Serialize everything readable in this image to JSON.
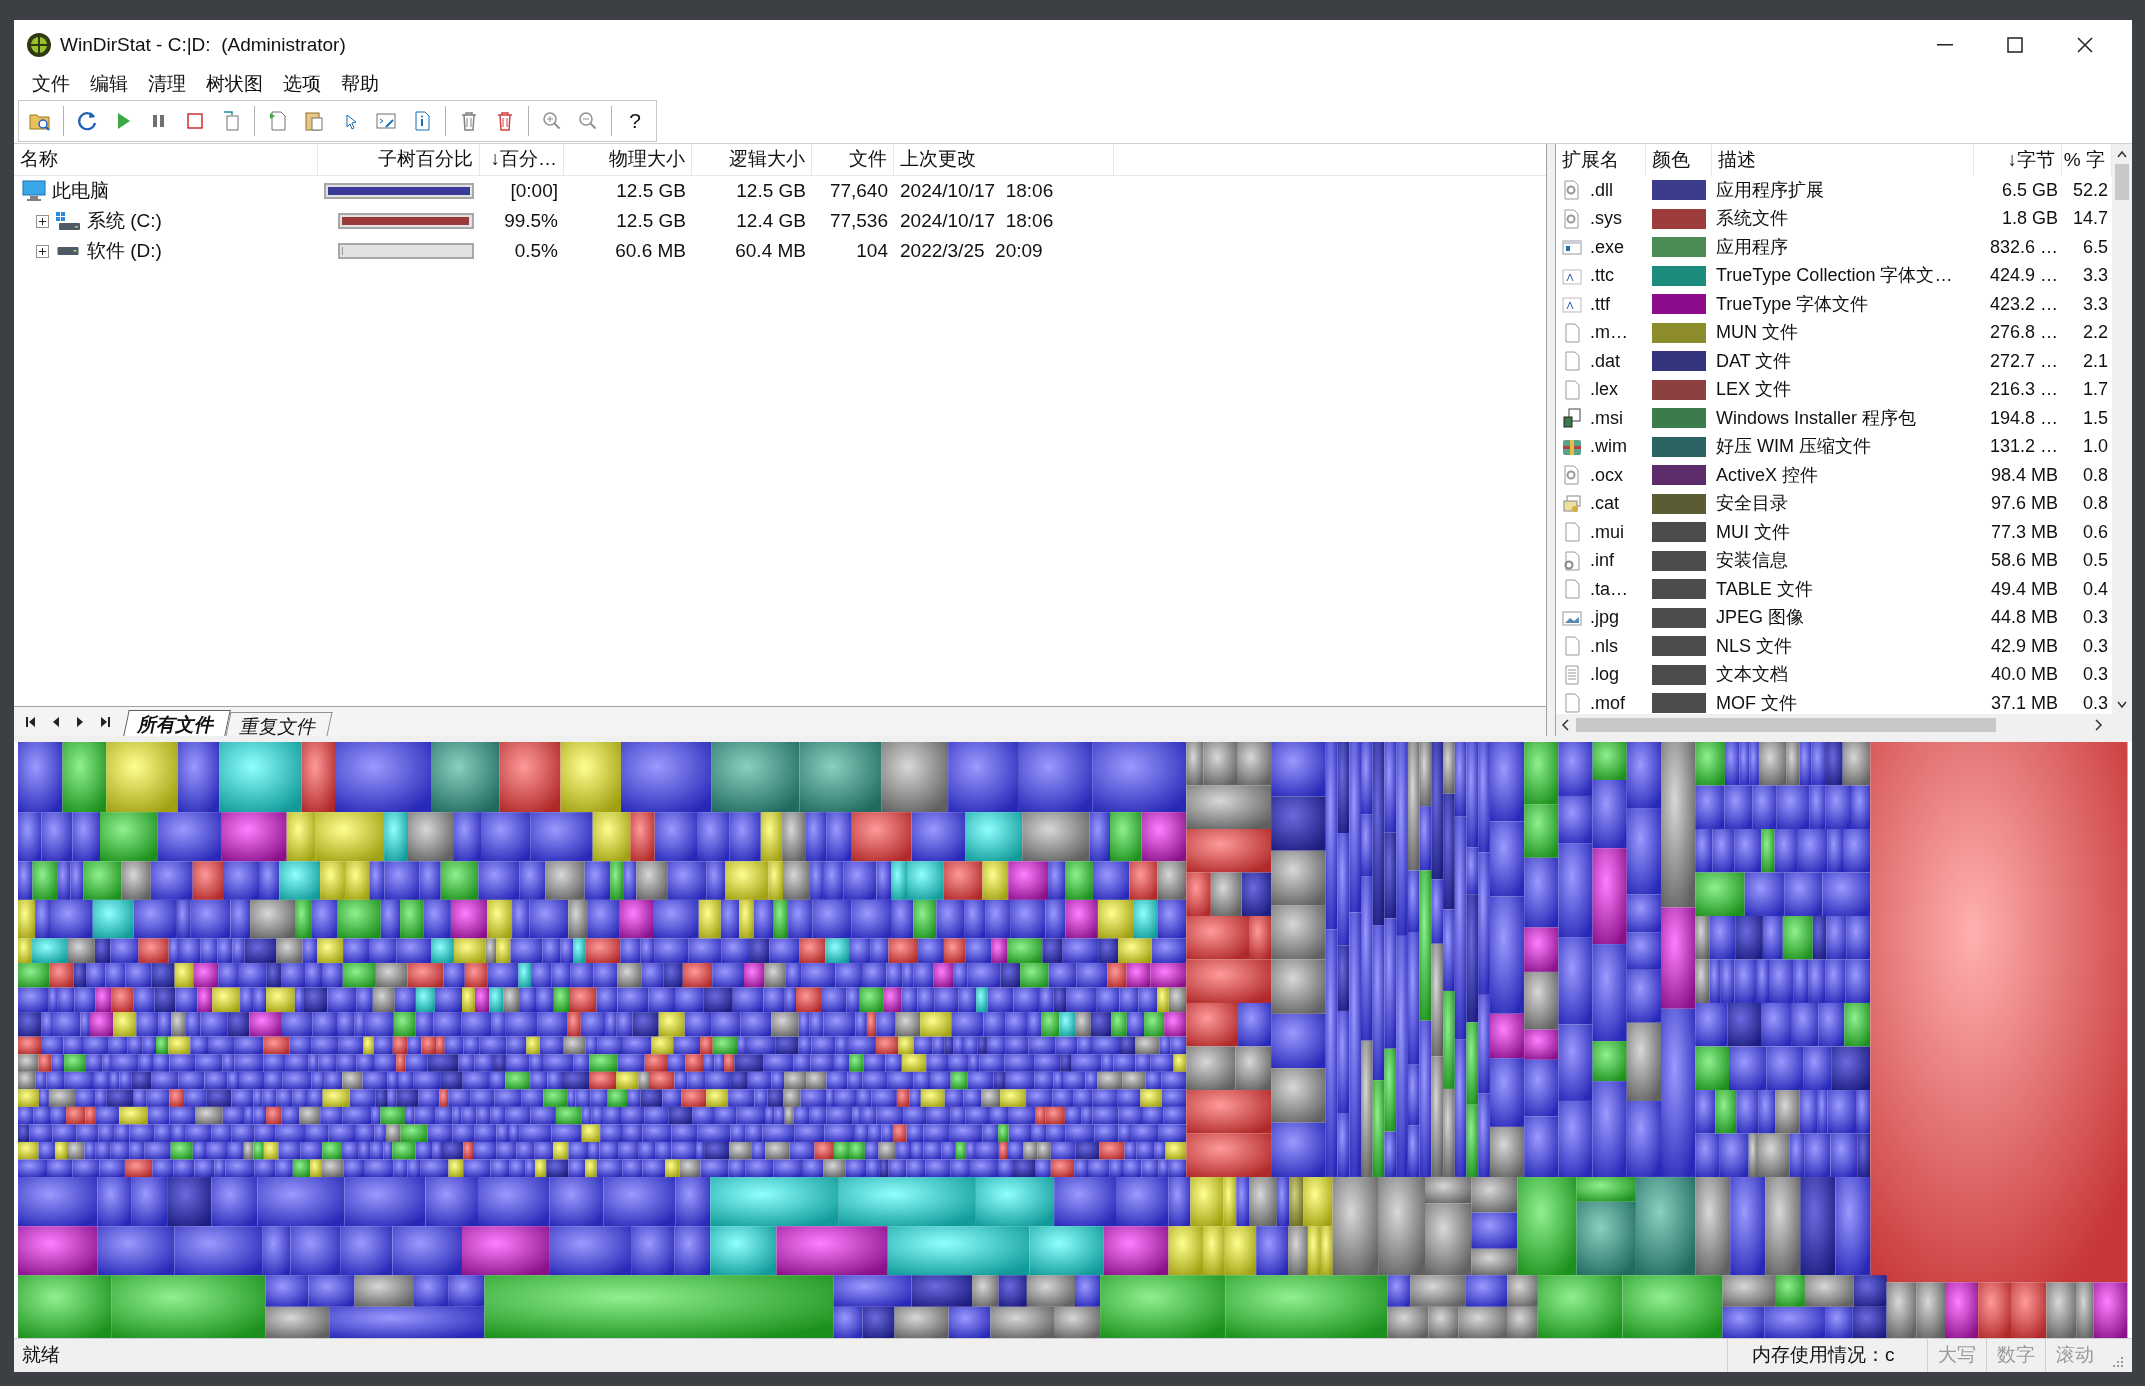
{
  "window": {
    "title": "WinDirStat - C:|D:  (Administrator)"
  },
  "menu": [
    "文件",
    "编辑",
    "清理",
    "树状图",
    "选项",
    "帮助"
  ],
  "toolbar": [
    {
      "kind": "open"
    },
    {
      "kind": "separator"
    },
    {
      "kind": "refresh"
    },
    {
      "kind": "play"
    },
    {
      "kind": "pause"
    },
    {
      "kind": "stop"
    },
    {
      "kind": "copy"
    },
    {
      "kind": "separator"
    },
    {
      "kind": "new-document"
    },
    {
      "kind": "paste"
    },
    {
      "kind": "pointer"
    },
    {
      "kind": "console"
    },
    {
      "kind": "info"
    },
    {
      "kind": "separator"
    },
    {
      "kind": "trash"
    },
    {
      "kind": "trash-red"
    },
    {
      "kind": "separator"
    },
    {
      "kind": "zoom-in"
    },
    {
      "kind": "zoom-out"
    },
    {
      "kind": "separator"
    },
    {
      "kind": "help",
      "label": "?"
    }
  ],
  "tree": {
    "columns": [
      "名称",
      "子树百分比",
      "↓百分…",
      "物理大小",
      "逻辑大小",
      "文件",
      "上次更改"
    ],
    "rows": [
      {
        "kind": "computer",
        "name": "此电脑",
        "color": "#3a3a9a",
        "level": 1,
        "percent": "[0:00]",
        "physical": "12.5 GB",
        "logical": "12.5 GB",
        "files": "77,640",
        "modified": "2024/10/17  18:06",
        "children": [
          {
            "kind": "system-drive",
            "name": "系统 (C:)",
            "expanded": false,
            "color": "#9a3a3a",
            "level": 0.995,
            "percent": "99.5%",
            "physical": "12.5 GB",
            "logical": "12.4 GB",
            "files": "77,536",
            "modified": "2024/10/17  18:06"
          },
          {
            "kind": "drive",
            "name": "软件 (D:)",
            "expanded": false,
            "color": "#9a9a9a",
            "level": 0.005,
            "percent": "0.5%",
            "physical": "60.6 MB",
            "logical": "60.4 MB",
            "files": "104",
            "modified": "2022/3/25  20:09"
          }
        ]
      }
    ]
  },
  "tabs": [
    {
      "label": "所有文件",
      "selected": true
    },
    {
      "label": "重复文件",
      "selected": false
    }
  ],
  "extensions": {
    "columns": [
      "扩展名",
      "颜色",
      "描述",
      "↓字节",
      "% 字"
    ],
    "rows": [
      {
        "kind": "gear-file",
        "ext": ".dll",
        "color": "#3c3c8c",
        "description": "应用程序扩展",
        "bytes": "6.5 GB",
        "percent": "52.2"
      },
      {
        "kind": "gear-file",
        "ext": ".sys",
        "color": "#9c3c3c",
        "description": "系统文件",
        "bytes": "1.8 GB",
        "percent": "14.7"
      },
      {
        "kind": "window",
        "ext": ".exe",
        "color": "#4c8c54",
        "description": "应用程序",
        "bytes": "832.6 …",
        "percent": "6.5"
      },
      {
        "kind": "font",
        "ext": ".ttc",
        "color": "#1c8c7c",
        "description": "TrueType Collection 字体文…",
        "bytes": "424.9 …",
        "percent": "3.3"
      },
      {
        "kind": "font",
        "ext": ".ttf",
        "color": "#8c0c8c",
        "description": "TrueType 字体文件",
        "bytes": "423.2 …",
        "percent": "3.3"
      },
      {
        "kind": "blank",
        "ext": ".m…",
        "color": "#8c8c2c",
        "description": "MUN 文件",
        "bytes": "276.8 …",
        "percent": "2.2"
      },
      {
        "kind": "blank",
        "ext": ".dat",
        "color": "#34347c",
        "description": "DAT 文件",
        "bytes": "272.7 …",
        "percent": "2.1"
      },
      {
        "kind": "blank",
        "ext": ".lex",
        "color": "#8c4040",
        "description": "LEX 文件",
        "bytes": "216.3 …",
        "percent": "1.7"
      },
      {
        "kind": "installer",
        "ext": ".msi",
        "color": "#3c7c4c",
        "description": "Windows Installer 程序包",
        "bytes": "194.8 …",
        "percent": "1.5"
      },
      {
        "kind": "archive",
        "ext": ".wim",
        "color": "#2c6464",
        "description": "好压 WIM 压缩文件",
        "bytes": "131.2 …",
        "percent": "1.0"
      },
      {
        "kind": "gear-file",
        "ext": ".ocx",
        "color": "#5c2c6c",
        "description": "ActiveX 控件",
        "bytes": "98.4 MB",
        "percent": "0.8"
      },
      {
        "kind": "certificate",
        "ext": ".cat",
        "color": "#5c5c34",
        "description": "安全目录",
        "bytes": "97.6 MB",
        "percent": "0.8"
      },
      {
        "kind": "blank",
        "ext": ".mui",
        "color": "#4c4c4c",
        "description": "MUI 文件",
        "bytes": "77.3 MB",
        "percent": "0.6"
      },
      {
        "kind": "settings-file",
        "ext": ".inf",
        "color": "#4c4c4c",
        "description": "安装信息",
        "bytes": "58.6 MB",
        "percent": "0.5"
      },
      {
        "kind": "blank",
        "ext": ".ta…",
        "color": "#4c4c4c",
        "description": "TABLE 文件",
        "bytes": "49.4 MB",
        "percent": "0.4"
      },
      {
        "kind": "image",
        "ext": ".jpg",
        "color": "#4c4c4c",
        "description": "JPEG 图像",
        "bytes": "44.8 MB",
        "percent": "0.3"
      },
      {
        "kind": "blank",
        "ext": ".nls",
        "color": "#4c4c4c",
        "description": "NLS 文件",
        "bytes": "42.9 MB",
        "percent": "0.3"
      },
      {
        "kind": "text",
        "ext": ".log",
        "color": "#4c4c4c",
        "description": "文本文档",
        "bytes": "40.0 MB",
        "percent": "0.3"
      },
      {
        "kind": "blank",
        "ext": ".mof",
        "color": "#4c4c4c",
        "description": "MOF 文件",
        "bytes": "37.1 MB",
        "percent": "0.3"
      }
    ]
  },
  "status_bar": {
    "message": "就绪",
    "memory": "内存使用情况：c",
    "indicators": [
      {
        "label": "大写",
        "disabled": true
      },
      {
        "label": "数字",
        "disabled": true
      },
      {
        "label": "滚动",
        "disabled": true
      }
    ]
  }
}
